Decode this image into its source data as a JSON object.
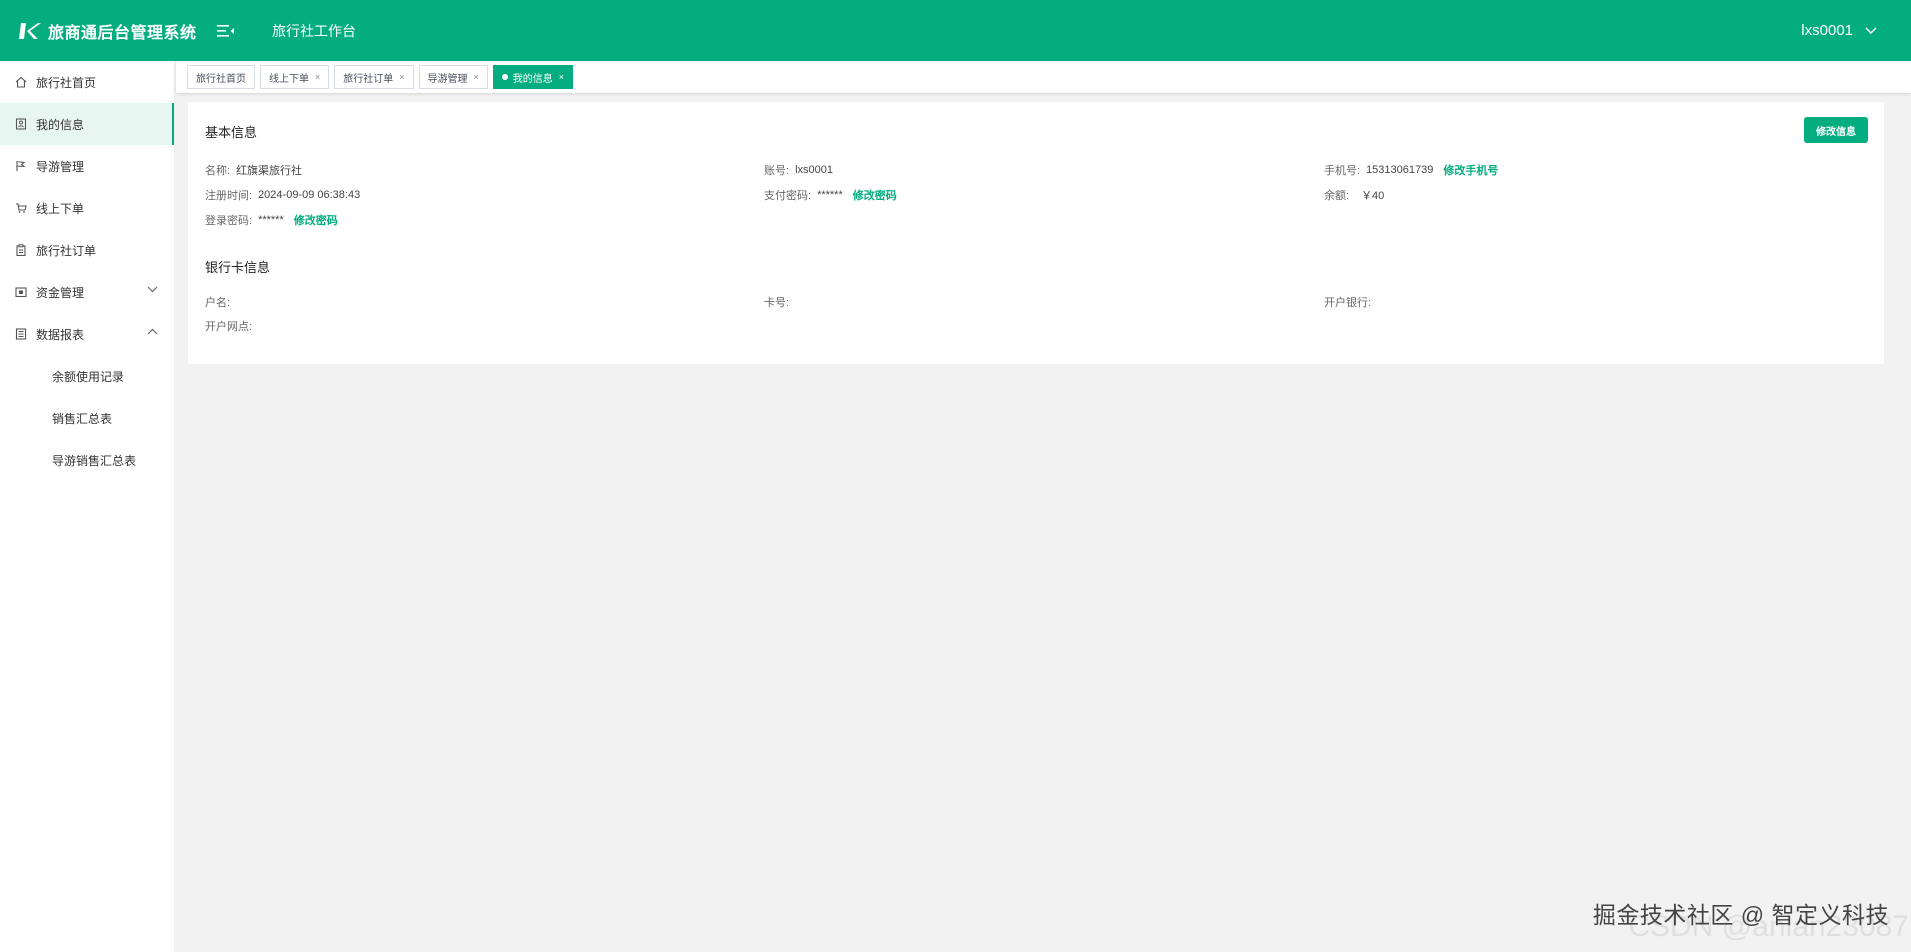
{
  "header": {
    "app_title": "旅商通后台管理系统",
    "workspace_title": "旅行社工作台",
    "username": "lxs0001"
  },
  "sidebar": {
    "items": [
      {
        "label": "旅行社首页",
        "icon": "home-icon"
      },
      {
        "label": "我的信息",
        "icon": "profile-icon"
      },
      {
        "label": "导游管理",
        "icon": "flag-icon"
      },
      {
        "label": "线上下单",
        "icon": "cart-icon"
      },
      {
        "label": "旅行社订单",
        "icon": "clipboard-icon"
      },
      {
        "label": "资金管理",
        "icon": "wallet-icon"
      },
      {
        "label": "数据报表",
        "icon": "report-icon"
      }
    ],
    "sub_items": [
      "余额使用记录",
      "销售汇总表",
      "导游销售汇总表"
    ],
    "active_index": 1
  },
  "tabs": [
    {
      "label": "旅行社首页",
      "closable": false
    },
    {
      "label": "线上下单",
      "closable": true
    },
    {
      "label": "旅行社订单",
      "closable": true
    },
    {
      "label": "导游管理",
      "closable": true
    },
    {
      "label": "我的信息",
      "closable": true,
      "active": true
    }
  ],
  "basic_info": {
    "title": "基本信息",
    "edit_button": "修改信息",
    "name_label": "名称:",
    "name_value": "红旗渠旅行社",
    "account_label": "账号:",
    "account_value": "lxs0001",
    "phone_label": "手机号:",
    "phone_value": "15313061739",
    "phone_link": "修改手机号",
    "reg_time_label": "注册时间:",
    "reg_time_value": "2024-09-09 06:38:43",
    "pay_pwd_label": "支付密码:",
    "pay_pwd_value": "******",
    "pay_pwd_link": "修改密码",
    "balance_label": "余额:",
    "balance_value": "￥40",
    "login_pwd_label": "登录密码:",
    "login_pwd_value": "******",
    "login_pwd_link": "修改密码"
  },
  "bank_info": {
    "title": "银行卡信息",
    "holder_label": "户名:",
    "card_label": "卡号:",
    "bank_label": "开户银行:",
    "branch_label": "开户网点:"
  },
  "watermark": "掘金技术社区 @ 智定义科技",
  "watermark_under": "CSDN @anlan23087",
  "colors": {
    "accent": "#04ad7f"
  }
}
